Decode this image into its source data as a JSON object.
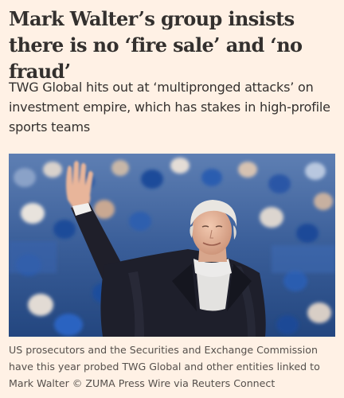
{
  "article": {
    "headline": "Mark Walter’s group insists there is no ‘fire sale’ and ‘no fraud’",
    "standfirst": "TWG Global hits out at ‘multipronged attacks’ on investment empire, which has stakes in high-profile sports teams",
    "image": {
      "subject": "man-waving-in-stadium-photo"
    },
    "caption": "US prosecutors and the Securities and Exchange Commission have this year probed TWG Global and other entities linked to Mark Walter © ZUMA Press Wire via Reuters Connect"
  },
  "colors": {
    "page_background": "#fff1e5",
    "text": "#33302e",
    "caption_text": "#55504c"
  }
}
